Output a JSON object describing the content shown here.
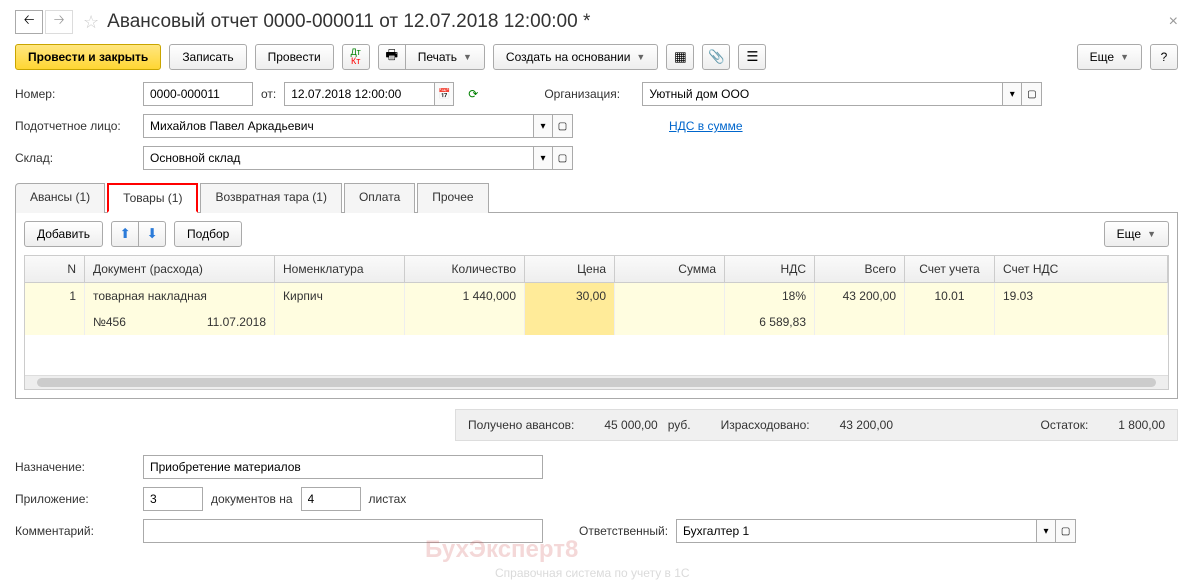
{
  "window": {
    "title": "Авансовый отчет 0000-000011 от 12.07.2018 12:00:00 *"
  },
  "toolbar": {
    "post_close": "Провести и закрыть",
    "save": "Записать",
    "post": "Провести",
    "print": "Печать",
    "create_based": "Создать на основании",
    "more": "Еще",
    "help": "?"
  },
  "form": {
    "number_label": "Номер:",
    "number": "0000-000011",
    "date_label": "от:",
    "date": "12.07.2018 12:00:00",
    "org_label": "Организация:",
    "org": "Уютный дом ООО",
    "person_label": "Подотчетное лицо:",
    "person": "Михайлов Павел Аркадьевич",
    "vat_link": "НДС в сумме",
    "warehouse_label": "Склад:",
    "warehouse": "Основной склад"
  },
  "tabs": {
    "advances": "Авансы (1)",
    "goods": "Товары (1)",
    "returnable": "Возвратная тара (1)",
    "payment": "Оплата",
    "other": "Прочее"
  },
  "tab_toolbar": {
    "add": "Добавить",
    "select": "Подбор",
    "more": "Еще"
  },
  "grid": {
    "headers": {
      "n": "N",
      "doc": "Документ (расхода)",
      "nom": "Номенклатура",
      "qty": "Количество",
      "price": "Цена",
      "sum": "Сумма",
      "nds": "НДС",
      "total": "Всего",
      "account": "Счет учета",
      "nds_account": "Счет НДС"
    },
    "rows": [
      {
        "n": "1",
        "doc": "товарная накладная",
        "doc2a": "№456",
        "doc2b": "11.07.2018",
        "nom": "Кирпич",
        "qty": "1 440,000",
        "price": "30,00",
        "sum": "",
        "nds": "18%",
        "nds2": "6 589,83",
        "total": "43 200,00",
        "account": "10.01",
        "nds_account": "19.03"
      }
    ]
  },
  "totals": {
    "advances_label": "Получено авансов:",
    "advances": "45 000,00",
    "currency": "руб.",
    "spent_label": "Израсходовано:",
    "spent": "43 200,00",
    "remainder_label": "Остаток:",
    "remainder": "1 800,00"
  },
  "footer": {
    "purpose_label": "Назначение:",
    "purpose": "Приобретение материалов",
    "attachment_label": "Приложение:",
    "attachment_docs": "3",
    "attachment_mid": "документов на",
    "attachment_pages": "4",
    "attachment_end": "листах",
    "comment_label": "Комментарий:",
    "comment": "",
    "responsible_label": "Ответственный:",
    "responsible": "Бухгалтер 1"
  },
  "watermark": {
    "main": "БухЭксперт8",
    "sub": "Справочная система по учету в 1С"
  }
}
